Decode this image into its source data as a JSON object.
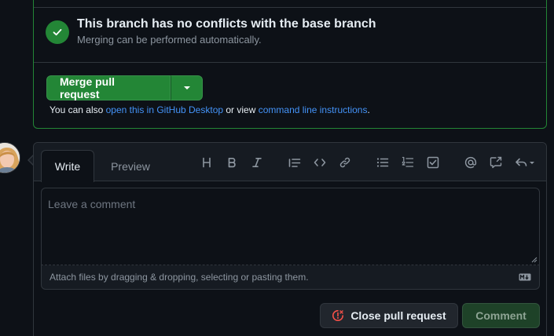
{
  "merge": {
    "status_title": "This branch has no conflicts with the base branch",
    "status_subtitle": "Merging can be performed automatically.",
    "merge_button_label": "Merge pull request",
    "alt_prefix": "You can also ",
    "alt_link_desktop": "open this in GitHub Desktop",
    "alt_middle": " or view ",
    "alt_link_cli": "command line instructions",
    "alt_suffix": "."
  },
  "comment": {
    "tabs": [
      {
        "label": "Write",
        "active": true
      },
      {
        "label": "Preview",
        "active": false
      }
    ],
    "toolbar_icons": [
      "heading-icon",
      "bold-icon",
      "italic-icon",
      "quote-icon",
      "code-icon",
      "link-icon",
      "unordered-list-icon",
      "ordered-list-icon",
      "task-list-icon",
      "mention-icon",
      "cross-reference-icon",
      "saved-replies-icon"
    ],
    "textarea_placeholder": "Leave a comment",
    "attach_text": "Attach files by dragging & dropping, selecting or pasting them.",
    "close_button_label": "Close pull request",
    "submit_button_label": "Comment"
  },
  "colors": {
    "background": "#0d1117",
    "border": "#30363d",
    "success": "#238636",
    "link": "#4493f8",
    "danger": "#f85149",
    "muted_text": "#8d96a0"
  }
}
